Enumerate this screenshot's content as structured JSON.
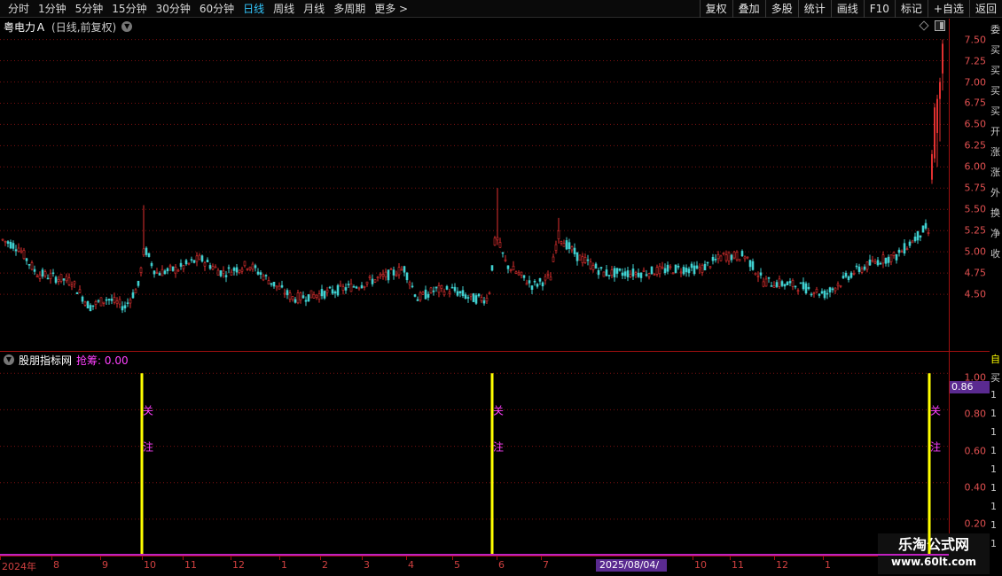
{
  "toolbar": {
    "tabs": [
      "分时",
      "1分钟",
      "5分钟",
      "15分钟",
      "30分钟",
      "60分钟",
      "日线",
      "周线",
      "月线",
      "多周期",
      "更多 >"
    ],
    "active_tab": "日线",
    "right_tools": [
      "复权",
      "叠加",
      "多股",
      "统计",
      "画线",
      "F10",
      "标记",
      "+自选",
      "返回"
    ]
  },
  "price_panel": {
    "stock_name": "粤电力Ａ",
    "period_label": "(日线,前复权)",
    "y_ticks": [
      "7.50",
      "7.25",
      "7.00",
      "6.75",
      "6.50",
      "6.25",
      "6.00",
      "5.75",
      "5.50",
      "5.25",
      "5.00",
      "4.75",
      "4.50"
    ]
  },
  "indicator_panel": {
    "name": "股朋指标网",
    "value_label": "抢筹: 0.00",
    "y_ticks": [
      "1.00",
      "0.80",
      "0.60",
      "0.40",
      "0.20"
    ],
    "cursor_value": "0.86",
    "signal_text_top": "关",
    "signal_text_bottom": "注"
  },
  "date_axis": {
    "labels": [
      "2024年",
      "8",
      "9",
      "10",
      "11",
      "12",
      "1",
      "2",
      "3",
      "4",
      "5",
      "6",
      "7",
      "10",
      "11",
      "12",
      "1"
    ],
    "cursor_date": "2025/08/04/—"
  },
  "side_strip": {
    "chars": [
      "委",
      "买",
      "买",
      "买",
      "买",
      "开",
      "涨",
      "涨",
      "外",
      "换",
      "净",
      "收",
      "自",
      "买",
      "1",
      "1",
      "1",
      "1",
      "1",
      "1",
      "1",
      "1",
      "1"
    ]
  },
  "watermark": {
    "title": "乐淘公式网",
    "url": "www.60lt.com"
  },
  "colors": {
    "up": "#e03030",
    "down": "#40d0d0",
    "signal": "#ffff00",
    "signal_text": "#ff40ff",
    "grid": "#7a1010",
    "accent_tab": "#33c8ff"
  },
  "chart_data": {
    "type": "candlestick",
    "price_axis_ticks": [
      7.5,
      7.25,
      7.0,
      6.75,
      6.5,
      6.25,
      6.0,
      5.75,
      5.5,
      5.25,
      5.0,
      4.75,
      4.5
    ],
    "ylim": [
      4.0,
      7.6
    ],
    "key_points": [
      {
        "label": "2024-07 start",
        "close": 5.15
      },
      {
        "label": "2024-09 low",
        "close": 4.35
      },
      {
        "label": "2024-10 spike high",
        "high": 5.55
      },
      {
        "label": "2025-06 spike high",
        "high": 5.75
      },
      {
        "label": "2025-07 high",
        "high": 5.4
      },
      {
        "label": "2025-08 low",
        "close": 4.5
      },
      {
        "label": "last bars high",
        "high": 7.45
      }
    ],
    "indicator": {
      "name": "股朋指标网",
      "ylim": [
        0,
        1.05
      ],
      "signal_value": 1.0,
      "signals": [
        "2024-10",
        "2025-06",
        "latest"
      ]
    }
  }
}
